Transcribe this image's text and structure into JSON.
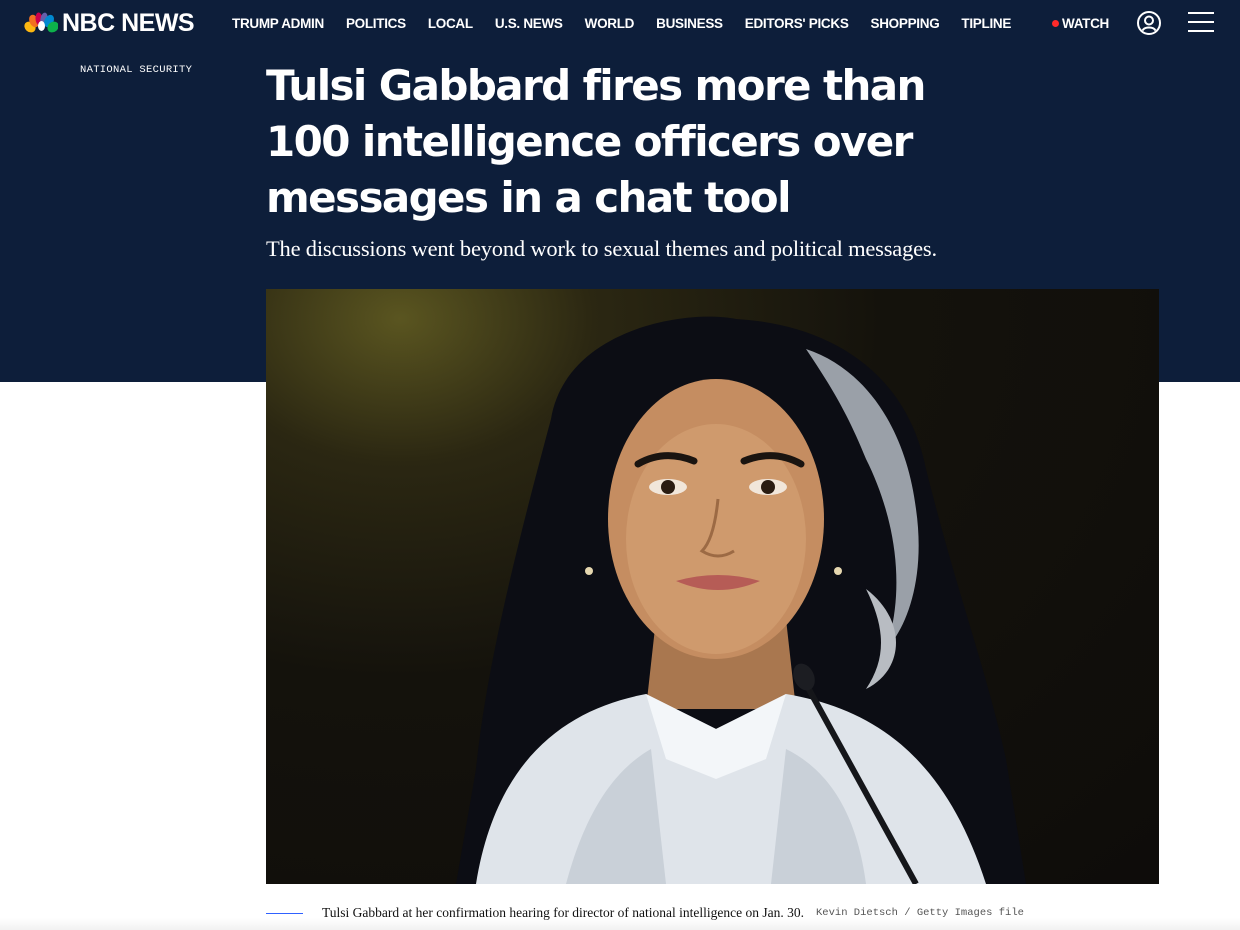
{
  "brand": {
    "name": "NBC NEWS",
    "peacock_colors": [
      "#fcb711",
      "#f37021",
      "#cc004c",
      "#6460aa",
      "#0089d0",
      "#0db14b"
    ]
  },
  "nav": {
    "items": [
      {
        "label": "TRUMP ADMIN"
      },
      {
        "label": "POLITICS"
      },
      {
        "label": "LOCAL"
      },
      {
        "label": "U.S. NEWS"
      },
      {
        "label": "WORLD"
      },
      {
        "label": "BUSINESS"
      },
      {
        "label": "EDITORS' PICKS"
      },
      {
        "label": "SHOPPING"
      },
      {
        "label": "TIPLINE"
      }
    ],
    "watch_label": "WATCH",
    "account_icon": "user-circle-icon",
    "menu_icon": "hamburger-menu-icon"
  },
  "article": {
    "section": "NATIONAL SECURITY",
    "headline": "Tulsi Gabbard fires more than 100 intelligence officers over messages in a chat tool",
    "dek": "The discussions went beyond work to sexual themes and political messages.",
    "image": {
      "caption": "Tulsi Gabbard at her confirmation hearing for director of national intelligence on Jan. 30.",
      "credit": "Kevin Dietsch / Getty Images file"
    }
  },
  "colors": {
    "hero_background": "#0d1e3a",
    "live_dot": "#ff2a2a",
    "caption_rule": "#3061ff"
  }
}
